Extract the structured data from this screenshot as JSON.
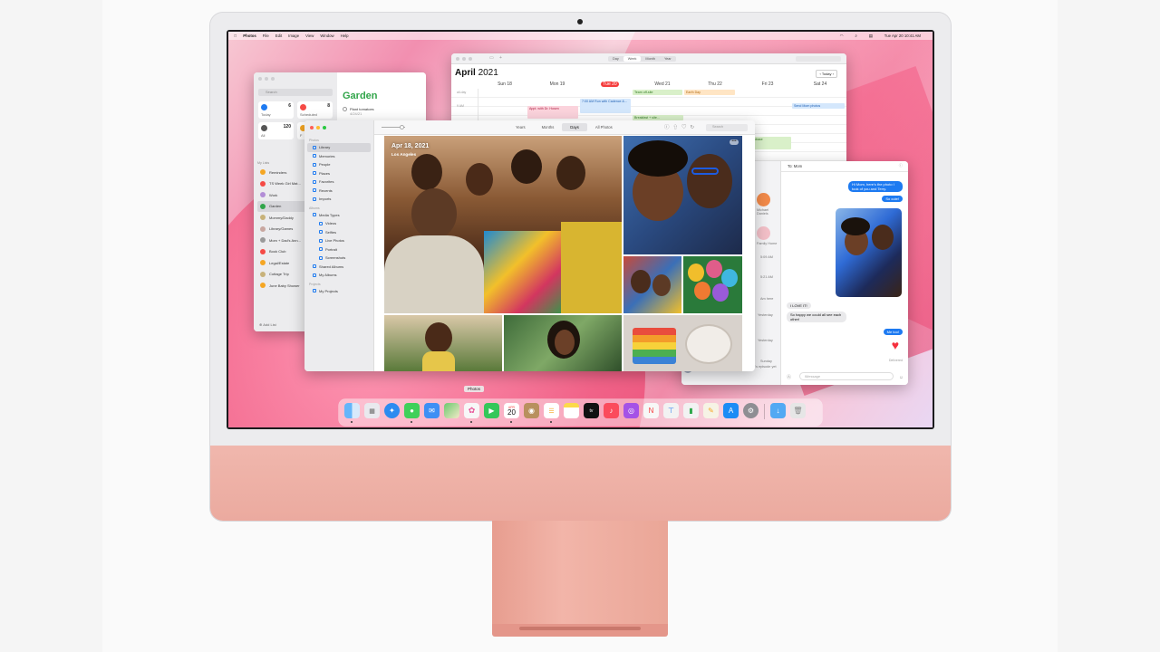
{
  "menubar": {
    "app": "Photos",
    "items": [
      "File",
      "Edit",
      "Image",
      "View",
      "Window",
      "Help"
    ],
    "clock": "Tue Apr 20  10:41 AM"
  },
  "reminders": {
    "search_placeholder": "Search",
    "tiles": [
      {
        "label": "Today",
        "count": "6",
        "color": "#1d7af1"
      },
      {
        "label": "Scheduled",
        "count": "8",
        "color": "#f54a45"
      },
      {
        "label": "All",
        "count": "120",
        "color": "#555555"
      },
      {
        "label": "F",
        "count": "",
        "color": "#f5a623"
      }
    ],
    "my_lists_header": "My Lists",
    "lists": [
      {
        "label": "Reminders",
        "color": "#f5a623"
      },
      {
        "label": "TS Week Girl Mat...",
        "color": "#f54a45"
      },
      {
        "label": "Work",
        "color": "#b28dd6"
      },
      {
        "label": "Garden",
        "color": "#31a54a"
      },
      {
        "label": "Mommy/Daddy",
        "color": "#c8b27a"
      },
      {
        "label": "Library/Games",
        "color": "#c9a7a0"
      },
      {
        "label": "Mom + Dad's Ann...",
        "color": "#9a9a9a"
      },
      {
        "label": "Book Club",
        "color": "#f54a45"
      },
      {
        "label": "Legal/Estate",
        "color": "#f5a623"
      },
      {
        "label": "Cottage Trip",
        "color": "#c8b27a"
      },
      {
        "label": "June Baby Shower",
        "color": "#f5a623"
      }
    ],
    "add_list": "Add List",
    "title": "Garden",
    "task": "Plant tomatoes",
    "task_date": "4/24/21"
  },
  "calendar": {
    "views": [
      "Day",
      "Week",
      "Month",
      "Year"
    ],
    "month": "April",
    "year": "2021",
    "today_button": "Today",
    "days": [
      "Sun 18",
      "Mon 19",
      "Tue 20",
      "Wed 21",
      "Thu 22",
      "Fri 23",
      "Sat 24"
    ],
    "all_day": "all-day",
    "time_label": "9 AM",
    "events": [
      {
        "text": "Team off-site"
      },
      {
        "text": "Earth Day"
      },
      {
        "text": "Appt. with Dr. Hosen"
      },
      {
        "text": "7:00 AM Run with Cadence &..."
      },
      {
        "text": "Breakfast + site..."
      },
      {
        "text": "Send Mom photos"
      },
      {
        "text": "touchbase"
      }
    ]
  },
  "photos": {
    "sections": {
      "photos": "Photos",
      "albums": "Albums",
      "projects": "Projects"
    },
    "library_items": [
      "Library",
      "Memories",
      "People",
      "Places",
      "Favorites",
      "Recents",
      "Imports"
    ],
    "album_items": [
      "Media Types",
      "Videos",
      "Selfies",
      "Live Photos",
      "Portrait",
      "Screenshots",
      "Shared Albums",
      "My Albums"
    ],
    "project_items": [
      "My Projects"
    ],
    "tabs": [
      "Years",
      "Months",
      "Days",
      "All Photos"
    ],
    "search_placeholder": "Search",
    "date": "Apr 18, 2021",
    "place": "Los Angeles"
  },
  "messages": {
    "to": "To: Mom",
    "bubbles": [
      {
        "text": "Hi Mom, here's the photo I took of you and Terry.",
        "side": "blue"
      },
      {
        "text": "So cute!",
        "side": "blue"
      },
      {
        "text": "I LOVE IT!",
        "side": "grey"
      },
      {
        "text": "So happy we could all see each other!",
        "side": "grey"
      },
      {
        "text": "Me too!",
        "side": "blue"
      },
      {
        "text": "Delivered",
        "side": "status"
      }
    ],
    "input_placeholder": "iMessage",
    "side_labels": [
      "Michael Daniels",
      "Family Home",
      "5:09 AM",
      "5:21 AM",
      "Am here",
      "Yesterday",
      "Yesterday",
      "Sunday",
      "No spoilers, I haven't watched last week's episode yet"
    ]
  },
  "dock": {
    "tooltip": "Photos",
    "calendar_month": "APR",
    "calendar_day": "20",
    "apps": [
      {
        "name": "finder",
        "color": "#4fa5f6"
      },
      {
        "name": "launchpad",
        "color": "#eaeaea"
      },
      {
        "name": "safari",
        "color": "#2d8bf0"
      },
      {
        "name": "messages",
        "color": "#3fd05a"
      },
      {
        "name": "mail",
        "color": "#3e8ff4"
      },
      {
        "name": "maps",
        "color": "#6bc96f"
      },
      {
        "name": "photos",
        "color": "#f4f4f4"
      },
      {
        "name": "facetime",
        "color": "#34c759"
      },
      {
        "name": "calendar",
        "color": "#ffffff"
      },
      {
        "name": "contacts",
        "color": "#b8905e"
      },
      {
        "name": "reminders",
        "color": "#ffffff"
      },
      {
        "name": "notes",
        "color": "#fcd94a"
      },
      {
        "name": "apple-tv",
        "color": "#111111"
      },
      {
        "name": "music",
        "color": "#fb4b5c"
      },
      {
        "name": "podcasts",
        "color": "#a552e6"
      },
      {
        "name": "news",
        "color": "#f7f7f7"
      },
      {
        "name": "keynote",
        "color": "#f2f2f2"
      },
      {
        "name": "numbers",
        "color": "#f2f2f2"
      },
      {
        "name": "pages",
        "color": "#f6f3e5"
      },
      {
        "name": "app-store",
        "color": "#1c8cf5"
      },
      {
        "name": "system-preferences",
        "color": "#8e8e93"
      },
      {
        "name": "downloads-folder",
        "color": "#53a9f3"
      },
      {
        "name": "trash",
        "color": "#e6e6e6"
      }
    ]
  }
}
